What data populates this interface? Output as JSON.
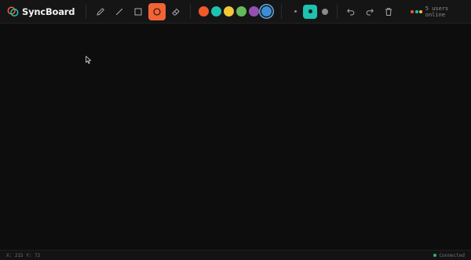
{
  "app": {
    "name": "SyncBoard",
    "logo_icon": "linked-rings-logo-icon"
  },
  "toolbar": {
    "tools": [
      {
        "id": "pencil",
        "icon": "pencil-icon",
        "active": false
      },
      {
        "id": "line",
        "icon": "line-icon",
        "active": false
      },
      {
        "id": "rectangle",
        "icon": "square-icon",
        "active": false
      },
      {
        "id": "circle",
        "icon": "circle-icon",
        "active": true
      },
      {
        "id": "eraser",
        "icon": "eraser-icon",
        "active": false
      }
    ],
    "active_tool_color": "#f26336",
    "colors": [
      {
        "name": "orange",
        "hex": "#f05a2a",
        "selected": false
      },
      {
        "name": "teal",
        "hex": "#1ec2b0",
        "selected": false
      },
      {
        "name": "yellow",
        "hex": "#f2c636",
        "selected": false
      },
      {
        "name": "green",
        "hex": "#64bb5b",
        "selected": false
      },
      {
        "name": "purple",
        "hex": "#9550b4",
        "selected": false
      },
      {
        "name": "blue",
        "hex": "#3a8ed6",
        "selected": true
      }
    ],
    "brush_sizes": [
      {
        "size": "small",
        "active": false
      },
      {
        "size": "medium",
        "active": true
      },
      {
        "size": "large",
        "active": false
      }
    ],
    "actions": [
      {
        "id": "undo",
        "icon": "undo-icon"
      },
      {
        "id": "redo",
        "icon": "redo-icon"
      },
      {
        "id": "clear",
        "icon": "trash-icon"
      }
    ],
    "presence": {
      "dot_colors": [
        "#f05a2a",
        "#1ec2b0",
        "#f2c636"
      ],
      "label": "5 users online"
    }
  },
  "status_bar": {
    "coords": "X: 215 Y: 72",
    "connection": "Connected",
    "connection_color": "#38b36a"
  }
}
